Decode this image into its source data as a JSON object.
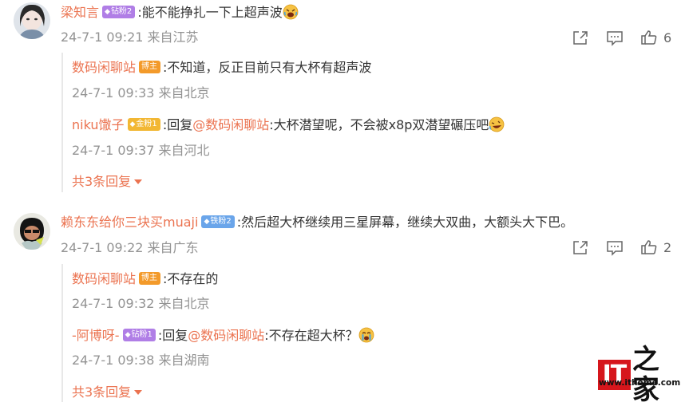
{
  "comments": [
    {
      "user": "梁知言",
      "badge": "钻粉2",
      "text": ":能不能挣扎一下上超声波",
      "time": "24-7-1 09:21 来自江苏",
      "likes": "6",
      "replies": [
        {
          "user": "数码闲聊站",
          "badge": "博主",
          "text": ":不知道，反正目前只有大杯有超声波",
          "time": "24-7-1 09:33 来自北京"
        },
        {
          "user": "niku馓子",
          "badge": "金粉1",
          "prefix": ":回复",
          "mention": "@数码闲聊站",
          "text": ":大杯潜望呢，不会被x8p双潜望碾压吧",
          "time": "24-7-1 09:37 来自河北"
        }
      ],
      "more": "共3条回复"
    },
    {
      "user": "赖东东给你三块买muaji",
      "badge": "铁粉2",
      "text": ":然后超大杯继续用三星屏幕，继续大双曲，大额头大下巴。",
      "time": "24-7-1 09:22 来自广东",
      "likes": "2",
      "replies": [
        {
          "user": "数码闲聊站",
          "badge": "博主",
          "text": ":不存在的",
          "time": "24-7-1 09:32 来自北京"
        },
        {
          "user": "-阿博呀-",
          "badge": "钻粉1",
          "prefix": ":回复",
          "mention": "@数码闲聊站",
          "text": ":不存在超大杯？",
          "time": "24-7-1 09:38 来自湖南"
        }
      ],
      "more": "共3条回复"
    }
  ],
  "watermark": {
    "logo_letters": "IT",
    "logo_char": "之家",
    "url": "www.ithome.com"
  },
  "colors": {
    "username": "#eb7350",
    "meta": "#939393",
    "badge_purple": "#b07ee6",
    "badge_blue": "#6aa5ea",
    "badge_gold": "#f2b733",
    "badge_orange": "#f39a2a",
    "logo_red": "#d6161c"
  },
  "icons": [
    "share-icon",
    "comment-icon",
    "like-icon",
    "diamond-icon",
    "crying-laughing-emoji",
    "laughing-emoji",
    "sob-emoji"
  ]
}
